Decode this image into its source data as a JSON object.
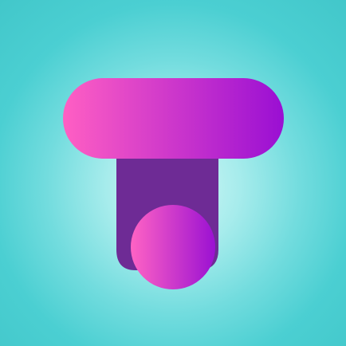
{
  "app": {
    "logo_icon": "letter-t-logo-icon"
  },
  "colors": {
    "background_center": "#d5f8f7",
    "background_edge": "#42c7ca",
    "bar_left": "#ff5fc3",
    "bar_right": "#9a0fd3",
    "stem": "#6e2b95",
    "ball_left": "#ff63c4",
    "ball_right": "#9b11d2"
  }
}
